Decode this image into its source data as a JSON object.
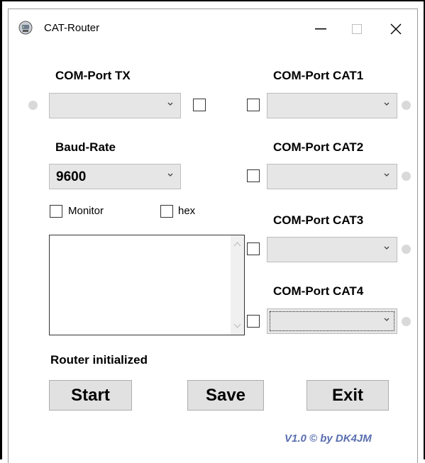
{
  "window": {
    "title": "CAT-Router",
    "icon": "router-app-icon"
  },
  "title_buttons": {
    "minimize": "–",
    "maximize": "☐",
    "close": "✕"
  },
  "left": {
    "tx_label": "COM-Port TX",
    "tx_value": "",
    "baud_label": "Baud-Rate",
    "baud_value": "9600",
    "monitor_label": "Monitor",
    "hex_label": "hex",
    "status": "Router initialized"
  },
  "right": {
    "cat1_label": "COM-Port CAT1",
    "cat2_label": "COM-Port CAT2",
    "cat3_label": "COM-Port CAT3",
    "cat4_label": "COM-Port CAT4"
  },
  "buttons": {
    "start": "Start",
    "save": "Save",
    "exit": "Exit"
  },
  "footer": {
    "version": "V1.0 © by DK4JM"
  },
  "colors": {
    "led_off": "#d9d9d9",
    "version_text": "#5a6fb0",
    "combo_bg": "#e6e6e6",
    "button_bg": "#e1e1e1"
  }
}
